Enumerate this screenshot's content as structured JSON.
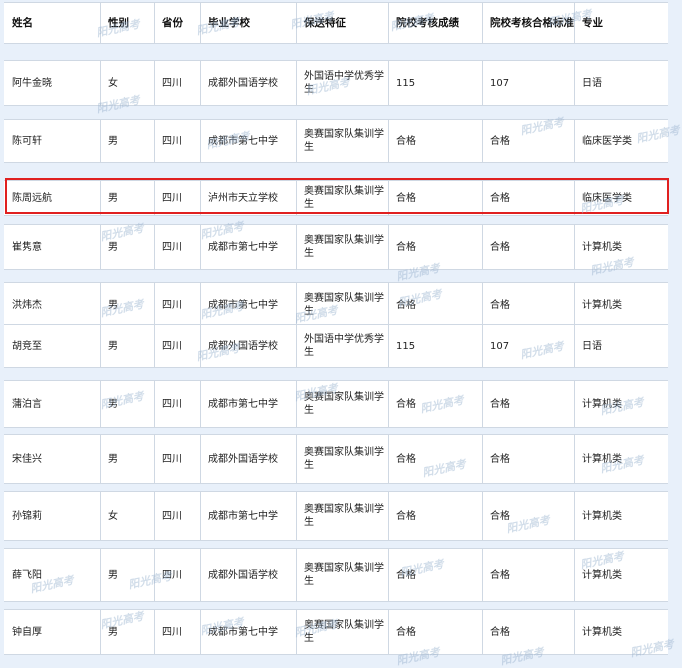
{
  "headers": [
    "姓名",
    "性别",
    "省份",
    "毕业学校",
    "保送特征",
    "院校考核成绩",
    "院校考核合格标准",
    "专业"
  ],
  "rows": [
    [
      "阿牛金晓",
      "女",
      "四川",
      "成都外国语学校",
      "外国语中学优秀学生",
      "115",
      "107",
      "日语"
    ],
    [
      "陈可轩",
      "男",
      "四川",
      "成都市第七中学",
      "奥赛国家队集训学生",
      "合格",
      "合格",
      "临床医学类"
    ],
    [
      "陈周远航",
      "男",
      "四川",
      "泸州市天立学校",
      "奥赛国家队集训学生",
      "合格",
      "合格",
      "临床医学类"
    ],
    [
      "崔隽意",
      "男",
      "四川",
      "成都市第七中学",
      "奥赛国家队集训学生",
      "合格",
      "合格",
      "计算机类"
    ],
    [
      "洪炜杰",
      "男",
      "四川",
      "成都市第七中学",
      "奥赛国家队集训学生",
      "合格",
      "合格",
      "计算机类"
    ],
    [
      "胡竞至",
      "男",
      "四川",
      "成都外国语学校",
      "外国语中学优秀学生",
      "115",
      "107",
      "日语"
    ],
    [
      "蒲泊言",
      "男",
      "四川",
      "成都市第七中学",
      "奥赛国家队集训学生",
      "合格",
      "合格",
      "计算机类"
    ],
    [
      "宋佳兴",
      "男",
      "四川",
      "成都外国语学校",
      "奥赛国家队集训学生",
      "合格",
      "合格",
      "计算机类"
    ],
    [
      "孙锦莉",
      "女",
      "四川",
      "成都市第七中学",
      "奥赛国家队集训学生",
      "合格",
      "合格",
      "计算机类"
    ],
    [
      "薛飞阳",
      "男",
      "四川",
      "成都外国语学校",
      "奥赛国家队集训学生",
      "合格",
      "合格",
      "计算机类"
    ],
    [
      "钟自厚",
      "男",
      "四川",
      "成都市第七中学",
      "奥赛国家队集训学生",
      "合格",
      "合格",
      "计算机类"
    ]
  ],
  "watermark": "阳光高考"
}
